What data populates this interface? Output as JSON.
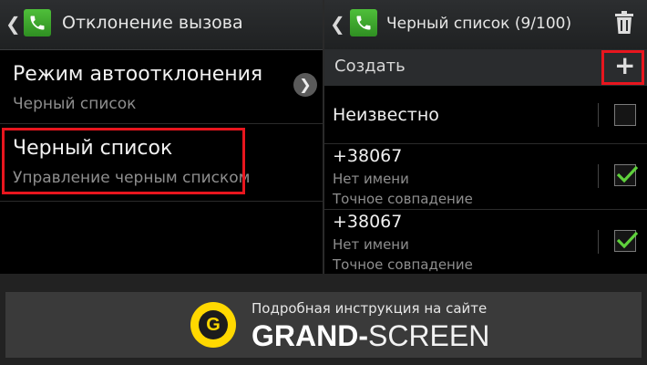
{
  "left_panel": {
    "title": "Отклонение вызова",
    "items": [
      {
        "title": "Режим автоотклонения",
        "subtitle": "Черный список"
      },
      {
        "title": "Черный список",
        "subtitle": "Управление черным списком"
      }
    ]
  },
  "right_panel": {
    "title": "Черный список (9/100)",
    "create_label": "Создать",
    "plus_glyph": "+",
    "unknown_label": "Неизвестно",
    "unknown_checked": false,
    "entries": [
      {
        "number": "+38067",
        "name": "Нет имени",
        "match": "Точное совпадение",
        "checked": true
      },
      {
        "number": "+38067",
        "name": "Нет имени",
        "match": "Точное совпадение",
        "checked": true
      }
    ]
  },
  "banner": {
    "small_text": "Подробная инструкция на сайте",
    "brand_bold": "GRAND-",
    "brand_light": "SCREEN",
    "badge_letter": "G"
  },
  "colors": {
    "highlight": "#e8161e",
    "check": "#5fd13c",
    "badge": "#ffd800",
    "phone_icon": "#3aa82a"
  },
  "icons": {
    "back": "chevron-left-icon",
    "phone": "phone-icon",
    "trash": "trash-icon",
    "next": "chevron-right-icon",
    "add": "plus-icon"
  }
}
